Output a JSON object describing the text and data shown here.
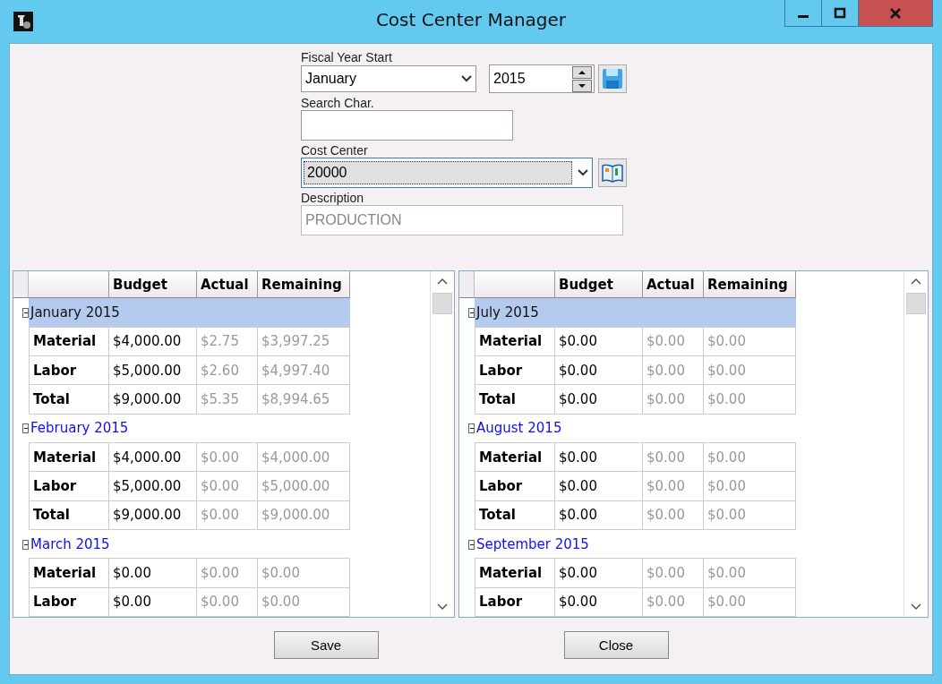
{
  "window": {
    "title": "Cost Center Manager"
  },
  "form": {
    "fiscal_year_start": {
      "label": "Fiscal Year Start",
      "month": "January",
      "year": "2015"
    },
    "search": {
      "label": "Search Char."
    },
    "cost_center": {
      "label": "Cost Center",
      "value": "20000"
    },
    "description": {
      "label": "Description",
      "value": "PRODUCTION",
      "disabled": true
    }
  },
  "grids": [
    {
      "columns": [
        "Budget",
        "Actual",
        "Remaining"
      ],
      "groups": [
        {
          "title": "January 2015",
          "selected": true,
          "expanded": true,
          "rows": [
            {
              "label": "Material",
              "budget": "$4,000.00",
              "actual": "$2.75",
              "remaining": "$3,997.25"
            },
            {
              "label": "Labor",
              "budget": "$5,000.00",
              "actual": "$2.60",
              "remaining": "$4,997.40"
            },
            {
              "label": "Total",
              "budget": "$9,000.00",
              "actual": "$5.35",
              "remaining": "$8,994.65"
            }
          ]
        },
        {
          "title": "February 2015",
          "selected": false,
          "expanded": true,
          "rows": [
            {
              "label": "Material",
              "budget": "$4,000.00",
              "actual": "$0.00",
              "remaining": "$4,000.00"
            },
            {
              "label": "Labor",
              "budget": "$5,000.00",
              "actual": "$0.00",
              "remaining": "$5,000.00"
            },
            {
              "label": "Total",
              "budget": "$9,000.00",
              "actual": "$0.00",
              "remaining": "$9,000.00"
            }
          ]
        },
        {
          "title": "March 2015",
          "selected": false,
          "expanded": true,
          "rows": [
            {
              "label": "Material",
              "budget": "$0.00",
              "actual": "$0.00",
              "remaining": "$0.00"
            },
            {
              "label": "Labor",
              "budget": "$0.00",
              "actual": "$0.00",
              "remaining": "$0.00"
            }
          ]
        }
      ]
    },
    {
      "columns": [
        "Budget",
        "Actual",
        "Remaining"
      ],
      "groups": [
        {
          "title": "July 2015",
          "selected": true,
          "expanded": true,
          "rows": [
            {
              "label": "Material",
              "budget": "$0.00",
              "actual": "$0.00",
              "remaining": "$0.00"
            },
            {
              "label": "Labor",
              "budget": "$0.00",
              "actual": "$0.00",
              "remaining": "$0.00"
            },
            {
              "label": "Total",
              "budget": "$0.00",
              "actual": "$0.00",
              "remaining": "$0.00"
            }
          ]
        },
        {
          "title": "August 2015",
          "selected": false,
          "expanded": true,
          "rows": [
            {
              "label": "Material",
              "budget": "$0.00",
              "actual": "$0.00",
              "remaining": "$0.00"
            },
            {
              "label": "Labor",
              "budget": "$0.00",
              "actual": "$0.00",
              "remaining": "$0.00"
            },
            {
              "label": "Total",
              "budget": "$0.00",
              "actual": "$0.00",
              "remaining": "$0.00"
            }
          ]
        },
        {
          "title": "September 2015",
          "selected": false,
          "expanded": true,
          "rows": [
            {
              "label": "Material",
              "budget": "$0.00",
              "actual": "$0.00",
              "remaining": "$0.00"
            },
            {
              "label": "Labor",
              "budget": "$0.00",
              "actual": "$0.00",
              "remaining": "$0.00"
            }
          ]
        }
      ]
    }
  ],
  "buttons": [
    "Save",
    "Close"
  ]
}
